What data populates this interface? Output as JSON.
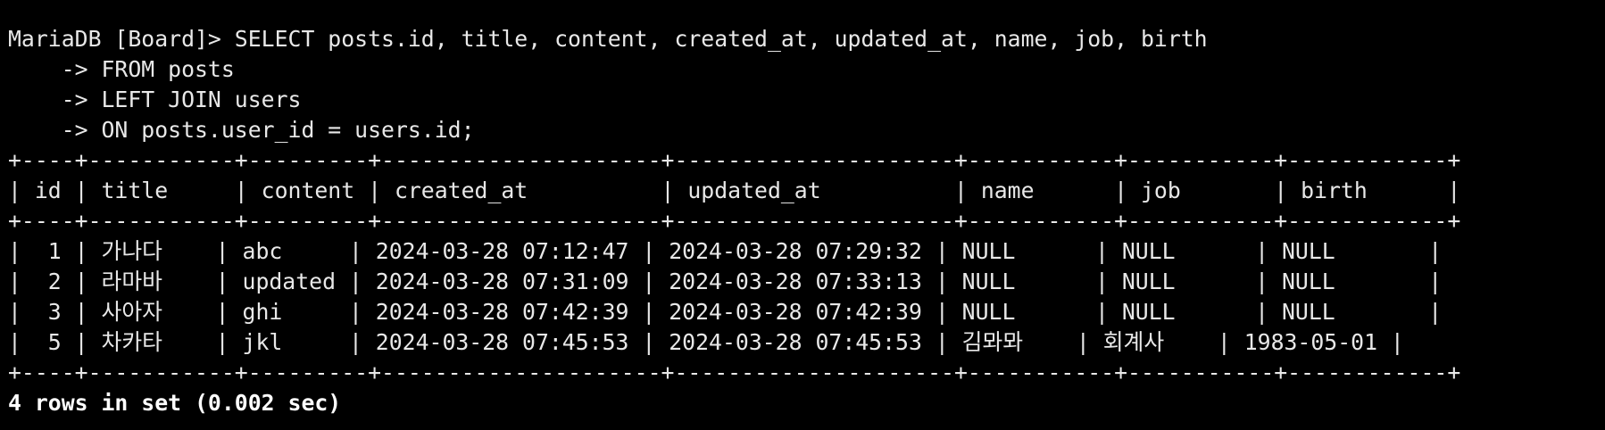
{
  "prompt": "MariaDB [Board]> ",
  "query": [
    "SELECT posts.id, title, content, created_at, updated_at, name, job, birth",
    "    -> FROM posts",
    "    -> LEFT JOIN users",
    "    -> ON posts.user_id = users.id;"
  ],
  "table": {
    "border": "+----+-----------+---------+---------------------+---------------------+-----------+-----------+------------+",
    "header": "| id | title     | content | created_at          | updated_at          | name      | job       | birth      |",
    "rows": [
      "|  1 | 가나다    | abc     | 2024-03-28 07:12:47 | 2024-03-28 07:29:32 | NULL      | NULL      | NULL       |",
      "|  2 | 라마바    | updated | 2024-03-28 07:31:09 | 2024-03-28 07:33:13 | NULL      | NULL      | NULL       |",
      "|  3 | 사아자    | ghi     | 2024-03-28 07:42:39 | 2024-03-28 07:42:39 | NULL      | NULL      | NULL       |",
      "|  5 | 차카타    | jkl     | 2024-03-28 07:45:53 | 2024-03-28 07:45:53 | 김뫄뫄    | 회계사    | 1983-05-01 |"
    ]
  },
  "result_summary": "4 rows in set (0.002 sec)"
}
